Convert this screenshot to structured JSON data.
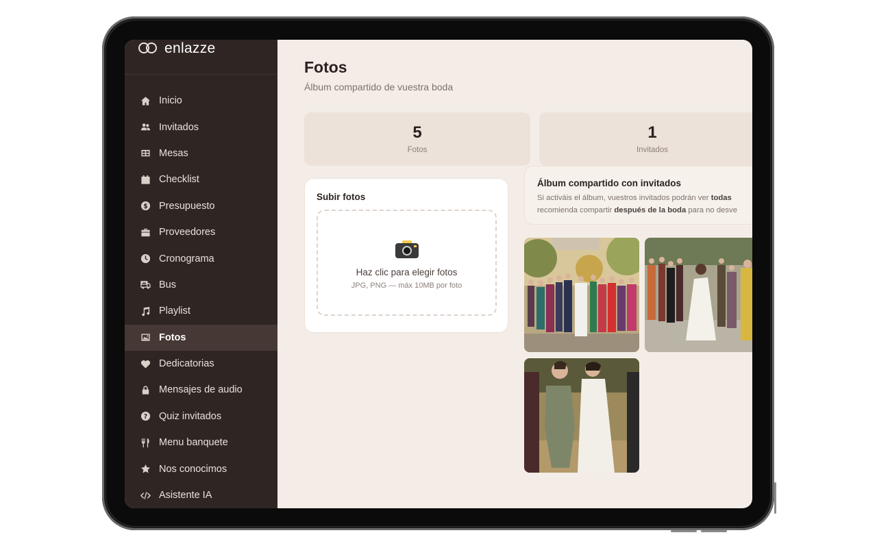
{
  "app": {
    "brand": "enlazze"
  },
  "sidebar": {
    "items": [
      {
        "label": "Inicio",
        "icon": "home-icon"
      },
      {
        "label": "Invitados",
        "icon": "users-icon"
      },
      {
        "label": "Mesas",
        "icon": "table-icon"
      },
      {
        "label": "Checklist",
        "icon": "calendar-icon"
      },
      {
        "label": "Presupuesto",
        "icon": "dollar-icon"
      },
      {
        "label": "Proveedores",
        "icon": "briefcase-icon"
      },
      {
        "label": "Cronograma",
        "icon": "clock-icon"
      },
      {
        "label": "Bus",
        "icon": "bus-icon"
      },
      {
        "label": "Playlist",
        "icon": "music-icon"
      },
      {
        "label": "Fotos",
        "icon": "image-icon",
        "active": true
      },
      {
        "label": "Dedicatorias",
        "icon": "heart-icon"
      },
      {
        "label": "Mensajes de audio",
        "icon": "lock-icon"
      },
      {
        "label": "Quiz invitados",
        "icon": "question-icon"
      },
      {
        "label": "Menu banquete",
        "icon": "utensils-icon"
      },
      {
        "label": "Nos conocimos",
        "icon": "star-icon"
      },
      {
        "label": "Asistente IA",
        "icon": "code-icon"
      }
    ]
  },
  "main": {
    "title": "Fotos",
    "subtitle": "Álbum compartido de vuestra boda",
    "stats": [
      {
        "value": "5",
        "label": "Fotos"
      },
      {
        "value": "1",
        "label": "Invitados"
      }
    ],
    "upload": {
      "title": "Subir fotos",
      "cta": "Haz clic para elegir fotos",
      "hint": "JPG, PNG — máx 10MB por foto",
      "icon": "camera-icon"
    },
    "share": {
      "title": "Álbum compartido con invitados",
      "line1_prefix": "Si activáis el álbum, vuestros invitados podrán ver ",
      "line1_bold": "todas",
      "line2_prefix": "recomienda compartir ",
      "line2_bold": "después de la boda",
      "line2_suffix": " para no desve"
    },
    "photos": [
      {
        "description": "group photo"
      },
      {
        "description": "bride dancing"
      },
      {
        "description": "bride with guest"
      }
    ]
  },
  "colors": {
    "sidebar_bg": "#2f2624",
    "sidebar_active": "#463834",
    "main_bg": "#f4ede7",
    "card_bg": "#ece2da",
    "text_dark": "#2b2220"
  }
}
